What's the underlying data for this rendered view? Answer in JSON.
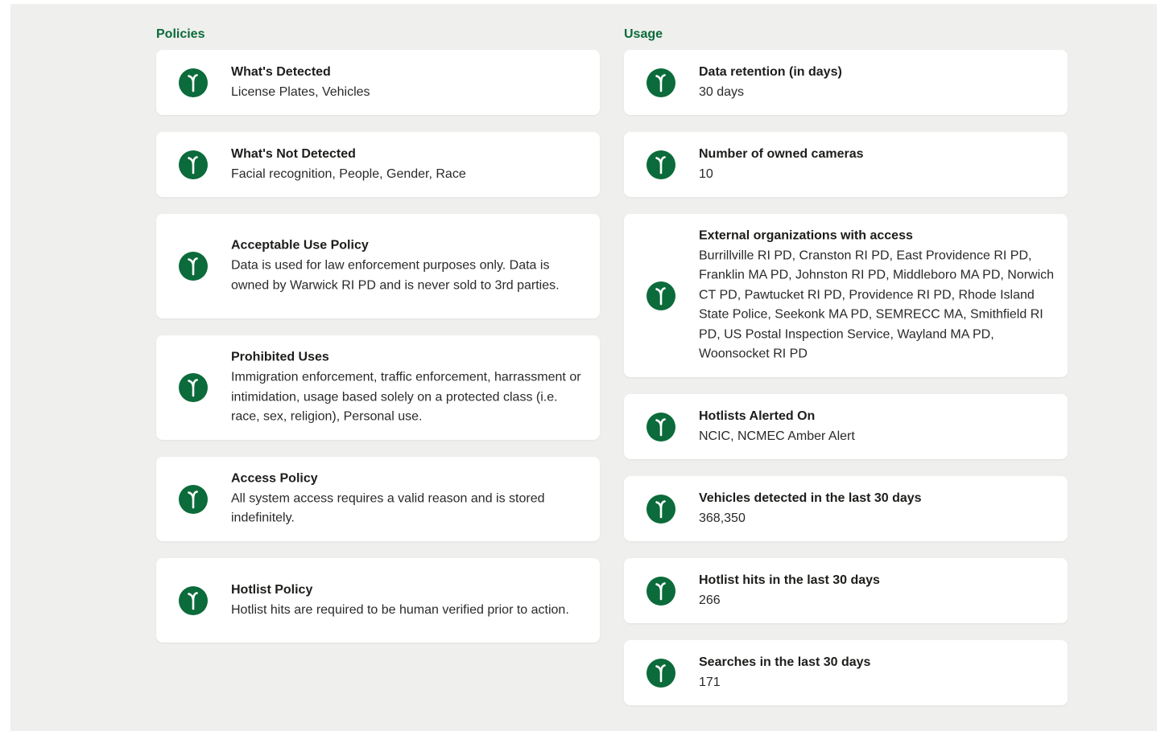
{
  "policies": {
    "heading": "Policies",
    "items": [
      {
        "title": "What's Detected",
        "value": "License Plates, Vehicles"
      },
      {
        "title": "What's Not Detected",
        "value": "Facial recognition, People, Gender, Race"
      },
      {
        "title": "Acceptable Use Policy",
        "value": "Data is used for law enforcement purposes only. Data is owned by Warwick RI PD and is never sold to 3rd parties."
      },
      {
        "title": "Prohibited Uses",
        "value": "Immigration enforcement, traffic enforcement, harrassment or intimidation, usage based solely on a protected class (i.e. race, sex, religion), Personal use."
      },
      {
        "title": "Access Policy",
        "value": "All system access requires a valid reason and is stored indefinitely."
      },
      {
        "title": "Hotlist Policy",
        "value": "Hotlist hits are required to be human verified prior to action."
      }
    ]
  },
  "usage": {
    "heading": "Usage",
    "items": [
      {
        "title": "Data retention (in days)",
        "value": "30 days"
      },
      {
        "title": "Number of owned cameras",
        "value": "10"
      },
      {
        "title": "External organizations with access",
        "value": "Burrillville RI PD, Cranston RI PD, East Providence RI PD, Franklin MA PD, Johnston RI PD, Middleboro MA PD, Norwich CT PD, Pawtucket RI PD, Providence RI PD, Rhode Island State Police, Seekonk MA PD, SEMRECC MA, Smithfield RI PD, US Postal Inspection Service, Wayland MA PD, Woonsocket RI PD"
      },
      {
        "title": "Hotlists Alerted On",
        "value": "NCIC, NCMEC Amber Alert"
      },
      {
        "title": "Vehicles detected in the last 30 days",
        "value": "368,350"
      },
      {
        "title": "Hotlist hits in the last 30 days",
        "value": "266"
      },
      {
        "title": "Searches in the last 30 days",
        "value": "171"
      }
    ]
  },
  "colors": {
    "accent": "#0b6b3a",
    "panel_background": "#efefed",
    "card_background": "#ffffff"
  },
  "icon": "sprout-icon"
}
